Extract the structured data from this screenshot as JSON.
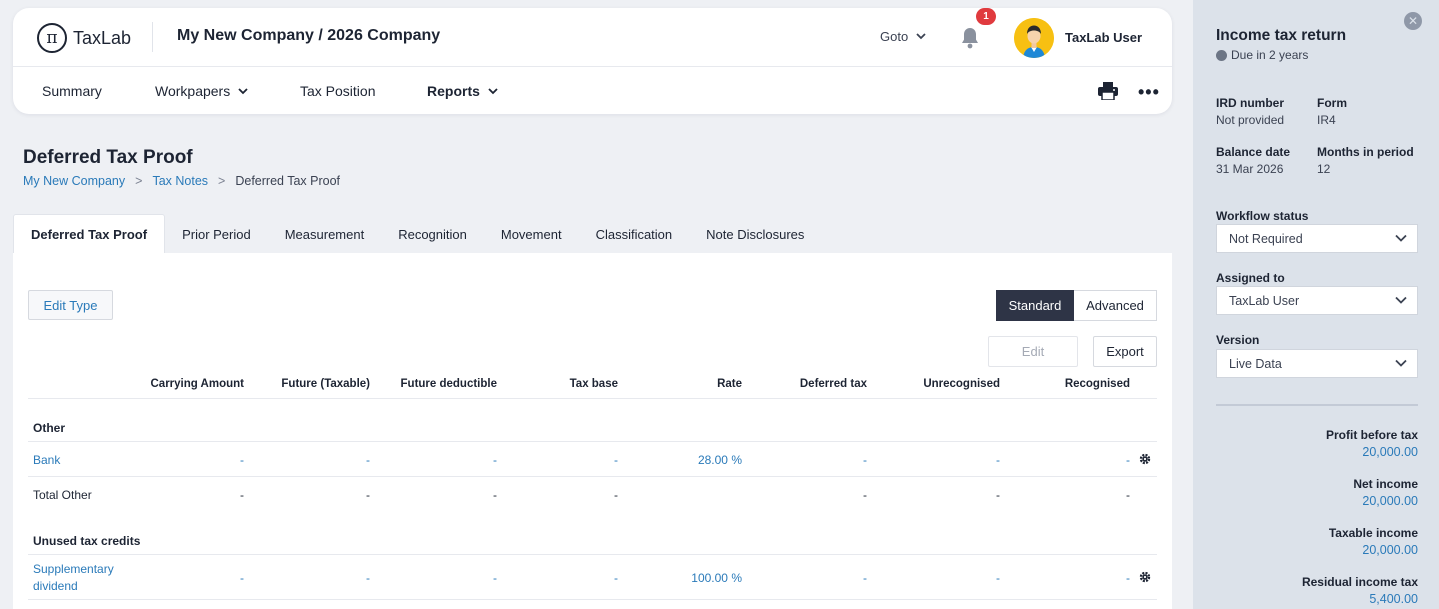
{
  "header": {
    "logo_text": "TaxLab",
    "company": "My New Company / 2026 Company",
    "goto_label": "Goto",
    "notification_count": "1",
    "user_name": "TaxLab User"
  },
  "nav": {
    "items": [
      {
        "label": "Summary"
      },
      {
        "label": "Workpapers"
      },
      {
        "label": "Tax Position"
      },
      {
        "label": "Reports"
      }
    ]
  },
  "page": {
    "title": "Deferred Tax Proof",
    "breadcrumb": [
      {
        "label": "My New Company"
      },
      {
        "label": "Tax Notes"
      },
      {
        "label": "Deferred Tax Proof"
      }
    ],
    "breadcrumb_sep": ">"
  },
  "tabs": [
    {
      "label": "Deferred Tax Proof",
      "active": true
    },
    {
      "label": "Prior Period"
    },
    {
      "label": "Measurement"
    },
    {
      "label": "Recognition"
    },
    {
      "label": "Movement"
    },
    {
      "label": "Classification"
    },
    {
      "label": "Note Disclosures"
    }
  ],
  "toolbar": {
    "edit_type_label": "Edit Type",
    "standard_label": "Standard",
    "advanced_label": "Advanced",
    "edit_label": "Edit",
    "export_label": "Export"
  },
  "table": {
    "columns": [
      "Carrying Amount",
      "Future (Taxable)",
      "Future deductible",
      "Tax base",
      "Rate",
      "Deferred tax",
      "Unrecognised",
      "Recognised"
    ],
    "sections": [
      {
        "title": "Other",
        "rows": [
          {
            "label": "Bank",
            "cells": [
              "-",
              "-",
              "-",
              "-",
              "28.00 %",
              "-",
              "-",
              "-"
            ]
          },
          {
            "label": "Total Other",
            "cells": [
              "-",
              "-",
              "-",
              "-",
              "",
              "-",
              "-",
              "-"
            ]
          }
        ]
      },
      {
        "title": "Unused tax credits",
        "rows": [
          {
            "label_line1": "Supplementary",
            "label_line2": "dividend",
            "cells": [
              "-",
              "-",
              "-",
              "-",
              "100.00 %",
              "-",
              "-",
              "-"
            ]
          }
        ]
      }
    ]
  },
  "sidebar": {
    "title": "Income tax return",
    "due": "Due in 2 years",
    "ird_label": "IRD number",
    "ird_value": "Not provided",
    "form_label": "Form",
    "form_value": "IR4",
    "balance_label": "Balance date",
    "balance_value": "31 Mar 2026",
    "months_label": "Months in period",
    "months_value": "12",
    "workflow_label": "Workflow status",
    "workflow_value": "Not Required",
    "assigned_label": "Assigned to",
    "assigned_value": "TaxLab User",
    "version_label": "Version",
    "version_value": "Live Data",
    "financials": [
      {
        "label": "Profit before tax",
        "value": "20,000.00"
      },
      {
        "label": "Net income",
        "value": "20,000.00"
      },
      {
        "label": "Taxable income",
        "value": "20,000.00"
      },
      {
        "label": "Residual income tax",
        "value": "5,400.00"
      }
    ]
  }
}
